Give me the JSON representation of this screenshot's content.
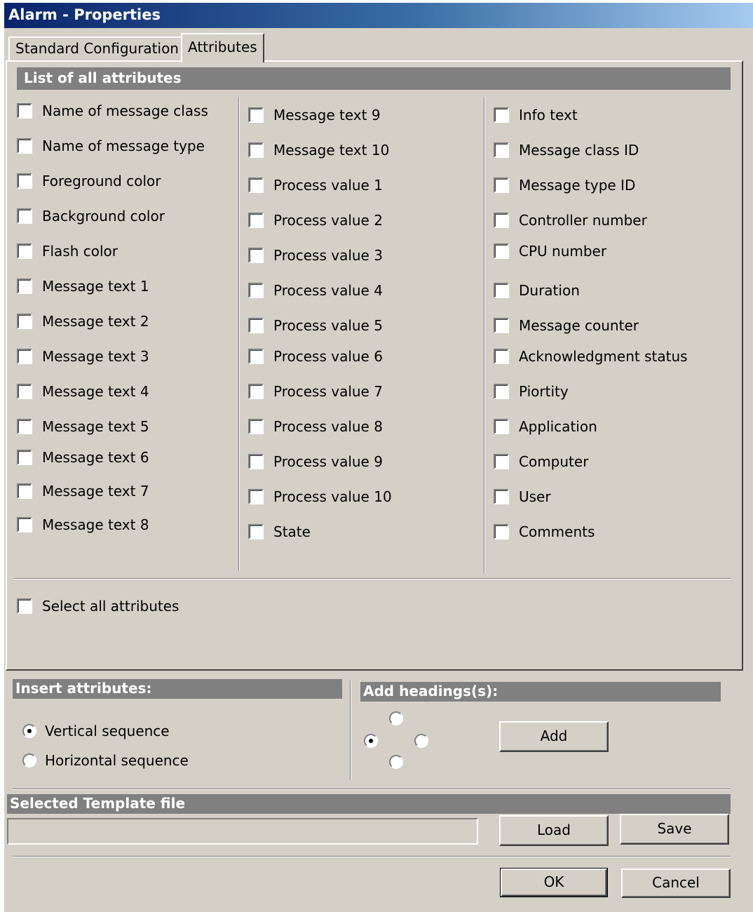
{
  "window": {
    "title": "Alarm - Properties"
  },
  "tabs": [
    {
      "label": "Standard Configuration",
      "active": false
    },
    {
      "label": "Attributes",
      "active": true
    }
  ],
  "attributes_section": {
    "heading": "List of all attributes",
    "columns": [
      [
        "Name of message class",
        "Name of message type",
        "Foreground color",
        "Background color",
        "Flash color",
        "Message text 1",
        "Message text 2",
        "Message text 3",
        "Message text 4",
        "Message text 5",
        "Message text 6",
        "Message text 7",
        "Message text 8"
      ],
      [
        "Message text 9",
        "Message text 10",
        "Process value 1",
        "Process value 2",
        "Process value 3",
        "Process value 4",
        "Process value 5",
        "Process value 6",
        "Process value 7",
        "Process value 8",
        "Process value 9",
        "Process value 10",
        "State"
      ],
      [
        "Info text",
        "Message class ID",
        "Message type ID",
        "Controller number",
        "CPU number",
        "Duration",
        "Message counter",
        "Acknowledgment status",
        "Piortity",
        "Application",
        "Computer",
        "User",
        "Comments"
      ]
    ],
    "select_all_label": "Select all attributes"
  },
  "insert_attributes": {
    "heading": "Insert attributes:",
    "options": [
      {
        "label": "Vertical sequence",
        "selected": true
      },
      {
        "label": "Horizontal sequence",
        "selected": false
      }
    ]
  },
  "add_headings": {
    "heading": "Add headings(s):",
    "positions_selected": "left",
    "add_label": "Add"
  },
  "template_file": {
    "heading": "Selected Template file",
    "value": "",
    "load_label": "Load",
    "save_label": "Save"
  },
  "footer": {
    "ok_label": "OK",
    "cancel_label": "Cancel"
  },
  "colors": {
    "title_start": "#0a246a",
    "title_end": "#a6caf0",
    "face": "#d4d0c8",
    "section_bar": "#808080"
  }
}
